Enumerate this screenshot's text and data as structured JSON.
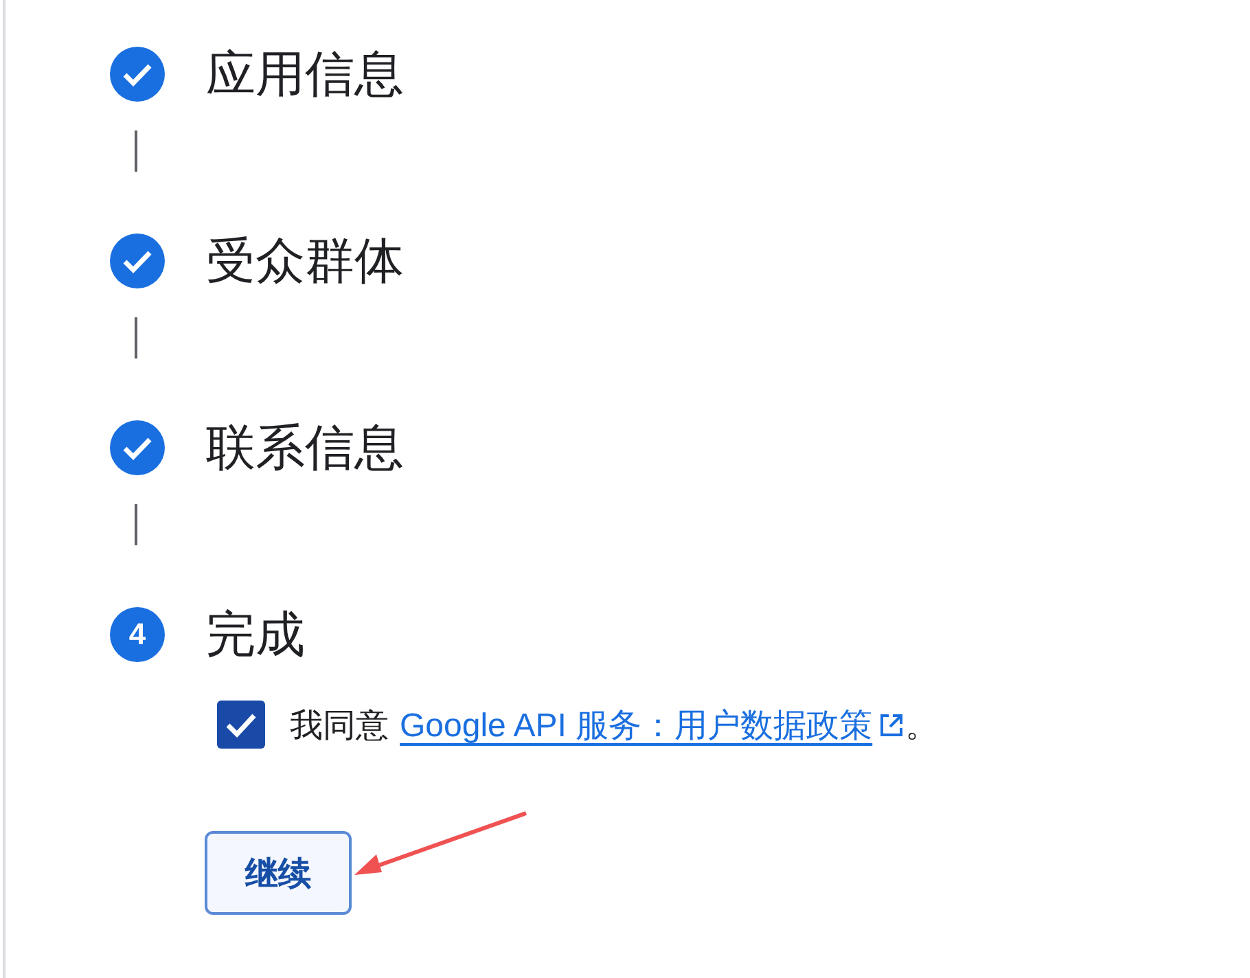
{
  "steps": [
    {
      "label": "应用信息",
      "kind": "done"
    },
    {
      "label": "受众群体",
      "kind": "done"
    },
    {
      "label": "联系信息",
      "kind": "done"
    },
    {
      "label": "完成",
      "kind": "current",
      "number": "4"
    }
  ],
  "consent": {
    "checked": true,
    "prefix": "我同意",
    "link": "Google API 服务：用户数据政策",
    "suffix": "。"
  },
  "continue_button": {
    "label": "继续"
  }
}
